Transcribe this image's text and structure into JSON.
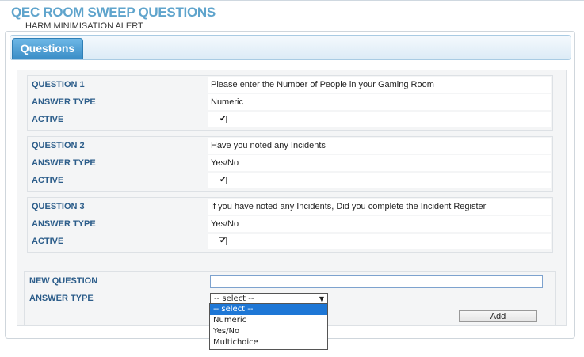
{
  "header": {
    "title": "QEC ROOM SWEEP QUESTIONS",
    "subtitle": "HARM MINIMISATION ALERT"
  },
  "tabs": [
    {
      "label": "Questions",
      "active": true
    }
  ],
  "questions": [
    {
      "question_label": "QUESTION 1",
      "question": "Please enter the Number of People in your Gaming Room",
      "answer_type_label": "ANSWER TYPE",
      "answer_type": "Numeric",
      "active_label": "ACTIVE",
      "active": true
    },
    {
      "question_label": "QUESTION 2",
      "question": "Have you noted any Incidents",
      "answer_type_label": "ANSWER TYPE",
      "answer_type": "Yes/No",
      "active_label": "ACTIVE",
      "active": true
    },
    {
      "question_label": "QUESTION 3",
      "question": "If you have noted any Incidents, Did you complete the Incident Register",
      "answer_type_label": "ANSWER TYPE",
      "answer_type": "Yes/No",
      "active_label": "ACTIVE",
      "active": true
    }
  ],
  "new_question": {
    "label": "NEW QUESTION",
    "value": "",
    "answer_type_label": "ANSWER TYPE",
    "answer_type_selected": "-- select --",
    "answer_type_options": [
      "-- select --",
      "Numeric",
      "Yes/No",
      "Multichoice"
    ],
    "add_button_label": "Add"
  },
  "colors": {
    "title": "#5fa4cc",
    "label": "#2c5d8a",
    "tab": "#3b8ec7",
    "selected_option": "#1e77d6"
  },
  "icons": {
    "checkbox_checked": "check-icon",
    "dropdown_arrow": "triangle-down-icon"
  }
}
